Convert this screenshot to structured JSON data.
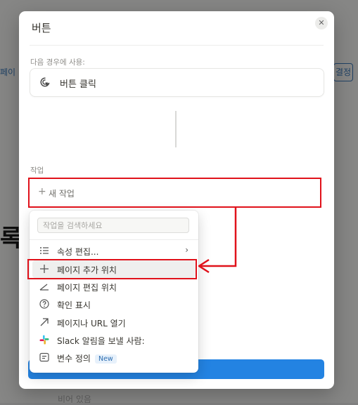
{
  "background": {
    "left_tab": "페이",
    "right_button": "결정",
    "big_text": "록",
    "bottom_text": "비어 있음"
  },
  "modal": {
    "title": "버튼",
    "close_icon": "✕",
    "trigger_section_label": "다음 경우에 사용:",
    "trigger_label": "버튼 클릭",
    "actions_section_label": "작업",
    "add_action_plus": "+",
    "add_action_label": "새 작업"
  },
  "menu": {
    "search_placeholder": "작업을 검색하세요",
    "items": [
      {
        "label": "속성 편집...",
        "icon": "list-icon",
        "has_submenu": true,
        "chevron": "›"
      },
      {
        "label": "페이지 추가 위치",
        "icon": "plus-icon",
        "highlighted": true
      },
      {
        "label": "페이지 편집 위치",
        "icon": "edit-angle-icon"
      },
      {
        "label": "확인 표시",
        "icon": "question-circle-icon"
      },
      {
        "label": "페이지나 URL 열기",
        "icon": "arrow-up-right-icon"
      },
      {
        "label": "Slack 알림을 보낼 사람:",
        "icon": "slack-icon"
      },
      {
        "label": "변수 정의",
        "icon": "variable-icon",
        "badge": "New"
      }
    ]
  },
  "colors": {
    "annotation_red": "#e0121b",
    "accent_blue": "#2383e2"
  }
}
